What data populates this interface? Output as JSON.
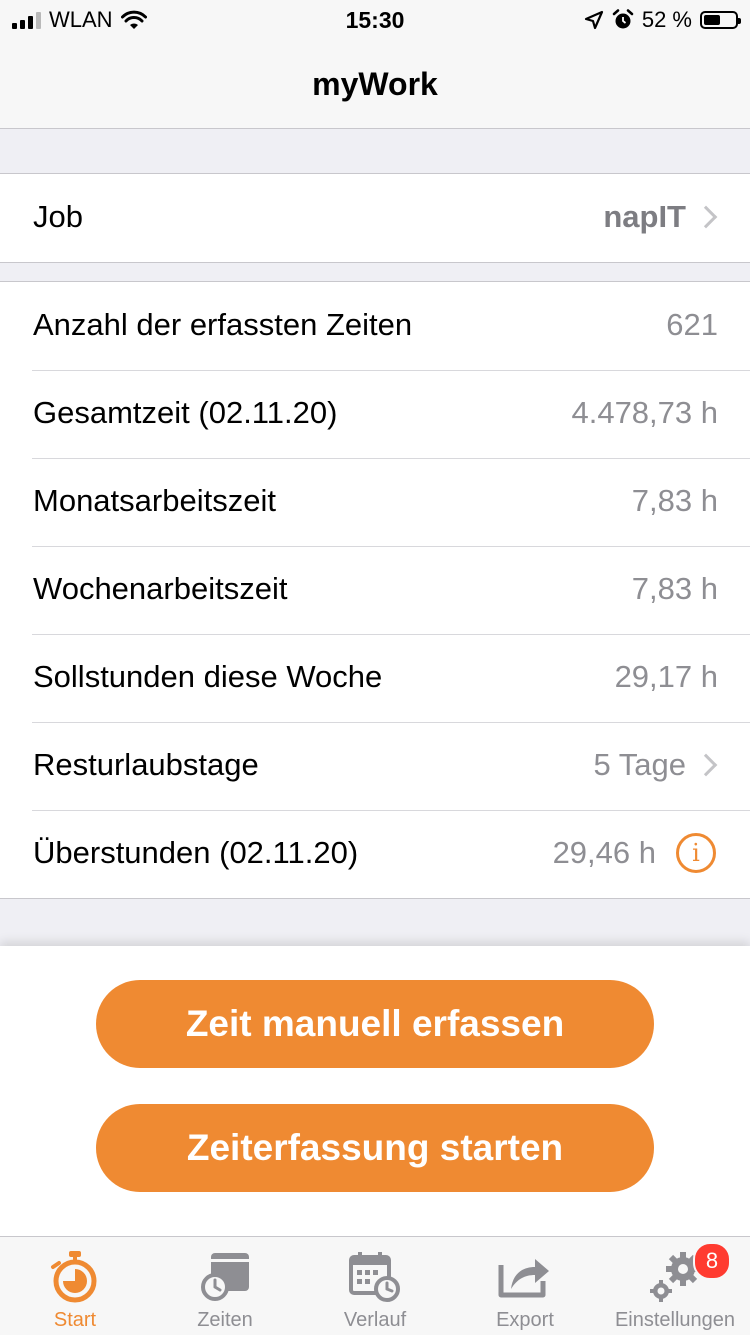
{
  "status_bar": {
    "carrier": "WLAN",
    "time": "15:30",
    "battery_percent": "52 %",
    "battery_level": 0.52
  },
  "nav": {
    "title": "myWork"
  },
  "job": {
    "label": "Job",
    "value": "napIT"
  },
  "stats": [
    {
      "label": "Anzahl der erfassten Zeiten",
      "value": "621"
    },
    {
      "label": "Gesamtzeit (02.11.20)",
      "value": "4.478,73 h"
    },
    {
      "label": "Monatsarbeitszeit",
      "value": "7,83 h"
    },
    {
      "label": "Wochenarbeitszeit",
      "value": "7,83 h"
    },
    {
      "label": "Sollstunden diese Woche",
      "value": "29,17 h"
    },
    {
      "label": "Resturlaubstage",
      "value": "5 Tage"
    },
    {
      "label": "Überstunden (02.11.20)",
      "value": "29,46 h"
    }
  ],
  "info_icon_glyph": "i",
  "actions": {
    "manual": "Zeit manuell erfassen",
    "start": "Zeiterfassung starten"
  },
  "tabs": [
    {
      "label": "Start",
      "icon": "stopwatch-icon",
      "active": true
    },
    {
      "label": "Zeiten",
      "icon": "times-list-icon",
      "active": false
    },
    {
      "label": "Verlauf",
      "icon": "calendar-clock-icon",
      "active": false
    },
    {
      "label": "Export",
      "icon": "share-icon",
      "active": false
    },
    {
      "label": "Einstellungen",
      "icon": "gears-icon",
      "active": false,
      "badge": "8"
    }
  ],
  "colors": {
    "accent": "#ef8a32",
    "badge": "#ff3b30",
    "inactive": "#8e8e93"
  }
}
